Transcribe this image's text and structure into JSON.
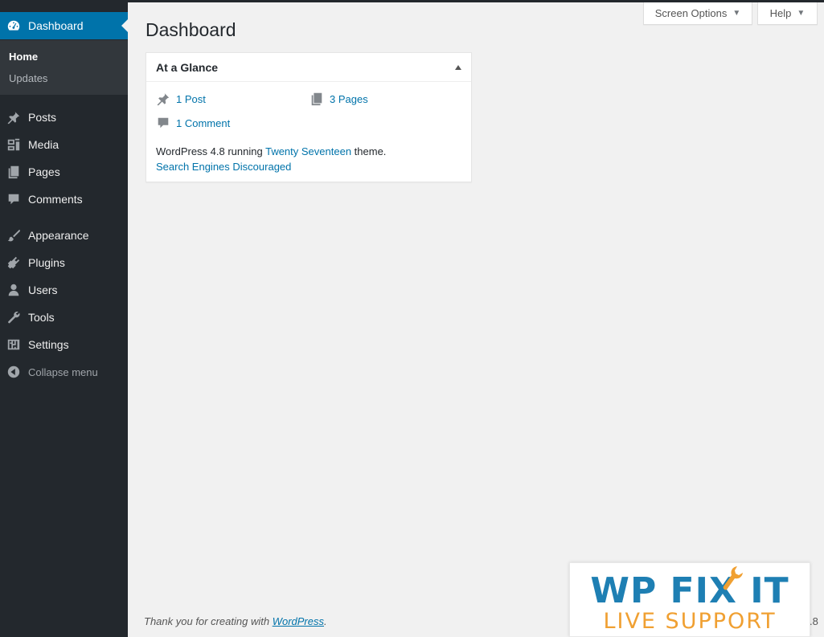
{
  "sidebar": {
    "items": [
      {
        "label": "Dashboard",
        "icon": "dashboard-icon"
      },
      {
        "label": "Posts",
        "icon": "pushpin-icon"
      },
      {
        "label": "Media",
        "icon": "media-icon"
      },
      {
        "label": "Pages",
        "icon": "pages-icon"
      },
      {
        "label": "Comments",
        "icon": "comment-icon"
      },
      {
        "label": "Appearance",
        "icon": "paintbrush-icon"
      },
      {
        "label": "Plugins",
        "icon": "plugin-icon"
      },
      {
        "label": "Users",
        "icon": "user-icon"
      },
      {
        "label": "Tools",
        "icon": "wrench-icon"
      },
      {
        "label": "Settings",
        "icon": "settings-icon"
      }
    ],
    "submenu": [
      {
        "label": "Home"
      },
      {
        "label": "Updates"
      }
    ],
    "collapse_label": "Collapse menu"
  },
  "header": {
    "screen_options": "Screen Options",
    "help": "Help",
    "title": "Dashboard"
  },
  "glance": {
    "title": "At a Glance",
    "posts": "1 Post",
    "pages": "3 Pages",
    "comments": "1 Comment",
    "version_prefix": "WordPress 4.8 running ",
    "theme_link": "Twenty Seventeen",
    "version_suffix": " theme.",
    "search_engines": "Search Engines Discouraged"
  },
  "footer": {
    "thanks_prefix": "Thank you for creating with ",
    "thanks_link": "WordPress",
    "thanks_suffix": ".",
    "version": ".8"
  },
  "badge": {
    "line1": "WP FIX IT",
    "line2": "LIVE SUPPORT"
  },
  "colors": {
    "sidebar_bg": "#23282d",
    "accent": "#0073aa",
    "badge_blue": "#1e7fb3",
    "badge_orange": "#f0a032"
  }
}
